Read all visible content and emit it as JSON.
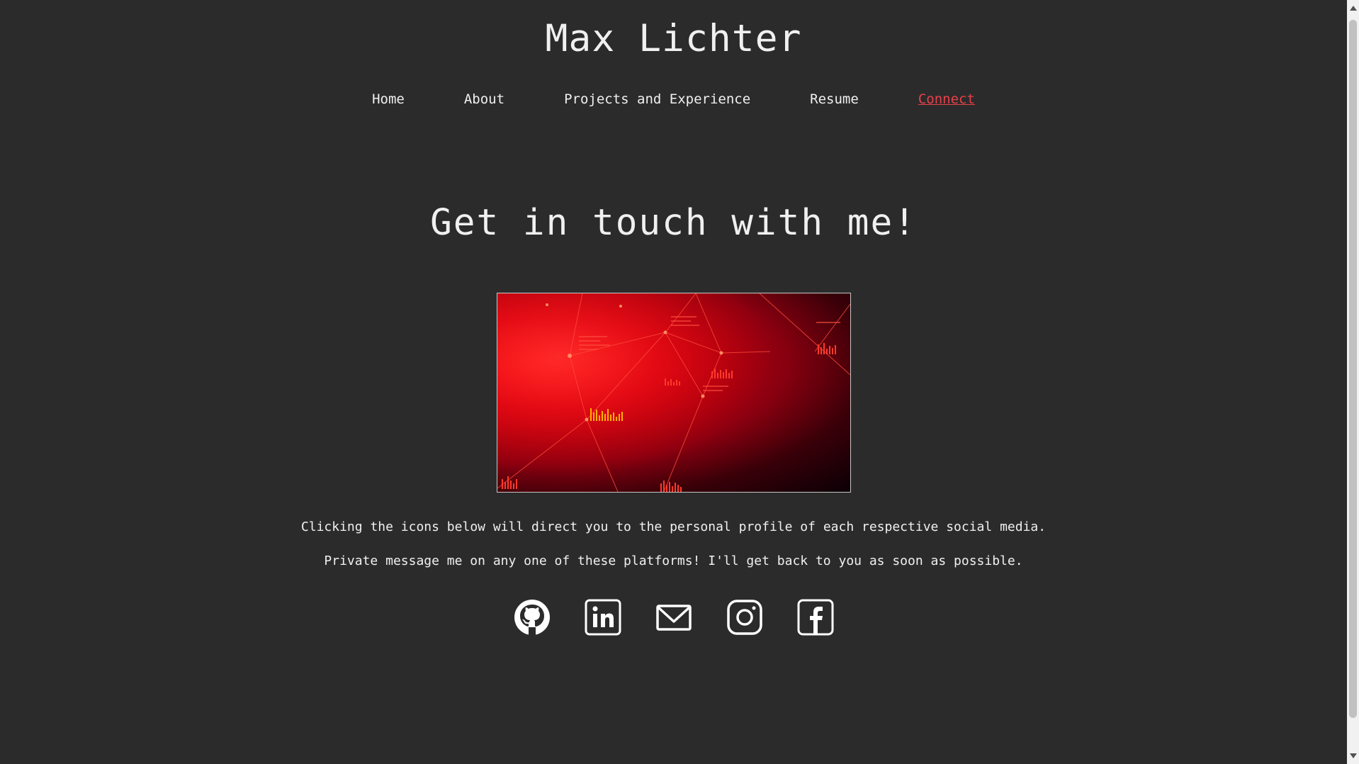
{
  "site": {
    "title": "Max Lichter"
  },
  "nav": {
    "items": [
      {
        "label": "Home",
        "active": false
      },
      {
        "label": "About",
        "active": false
      },
      {
        "label": "Projects and Experience",
        "active": false
      },
      {
        "label": "Resume",
        "active": false
      },
      {
        "label": "Connect",
        "active": true
      }
    ]
  },
  "main": {
    "heading": "Get in touch with me!",
    "paragraph1": "Clicking the icons below will direct you to the personal profile of each respective social media.",
    "paragraph2": "Private message me on any one of these platforms! I'll get back to you as soon as possible.",
    "socials": [
      {
        "icon": "github-icon"
      },
      {
        "icon": "linkedin-icon"
      },
      {
        "icon": "email-icon"
      },
      {
        "icon": "instagram-icon"
      },
      {
        "icon": "facebook-icon"
      }
    ]
  },
  "colors": {
    "background": "#2b2b2b",
    "text": "#f0f0f0",
    "accent": "#e8404a"
  }
}
